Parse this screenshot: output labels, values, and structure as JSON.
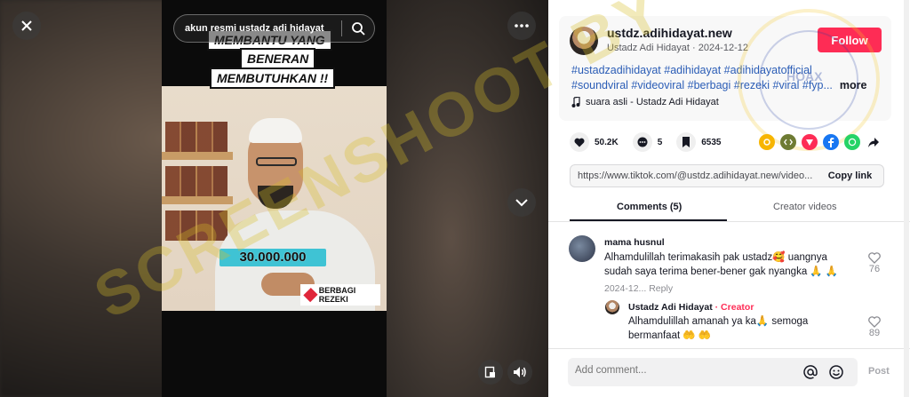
{
  "video": {
    "search_text": "akun resmi ustadz adi hidayat",
    "caption_lines": [
      "MEMBANTU YANG",
      "BENERAN",
      "MEMBUTUHKAN !!"
    ],
    "money": "30.000.000",
    "badge": "BERBAGI REZEKI",
    "watermark": "SCREENSHOOT BY"
  },
  "post": {
    "author": "ustdz.adihidayat.new",
    "subtitle": "Ustadz Adi Hidayat · 2024-12-12",
    "follow_label": "Follow",
    "tags_line1": "#ustadzadihidayat #adihidayat #adihidayatofficial",
    "tags_line2": "#soundviral #videoviral #berbagi #rezeki #viral #fyp...",
    "more_label": "more",
    "music": "suara asli - Ustadz Adi Hidayat",
    "seal_text": "HOAX"
  },
  "stats": {
    "likes": "50.2K",
    "comments": "5",
    "saves": "6535"
  },
  "share_colors": {
    "friends": "#f7b500",
    "embed": "#6e7b33",
    "send": "#fe2c55",
    "facebook": "#1877f2",
    "whatsapp": "#25d366",
    "share": "#161823"
  },
  "link": {
    "url": "https://www.tiktok.com/@ustdz.adihidayat.new/video...",
    "copy_label": "Copy link"
  },
  "tabs": {
    "comments": "Comments (5)",
    "creator_videos": "Creator videos"
  },
  "comments": [
    {
      "name": "mama husnul",
      "text_line1": "Alhamdulillah terimakasih pak ustadz🥰 uangnya",
      "text_line2": "sudah saya terima bener-bener gak nyangka 🙏 🙏",
      "date": "2024-12...",
      "reply": "Reply",
      "likes": "76"
    },
    {
      "name": "Ustadz Adi Hidayat",
      "creator_label": "· Creator",
      "text_line1": "Alhamdulillah amanah ya ka🙏 semoga",
      "text_line2": "bermanfaat 🤲 🤲",
      "likes": "89"
    }
  ],
  "composer": {
    "placeholder": "Add comment...",
    "post_label": "Post"
  }
}
